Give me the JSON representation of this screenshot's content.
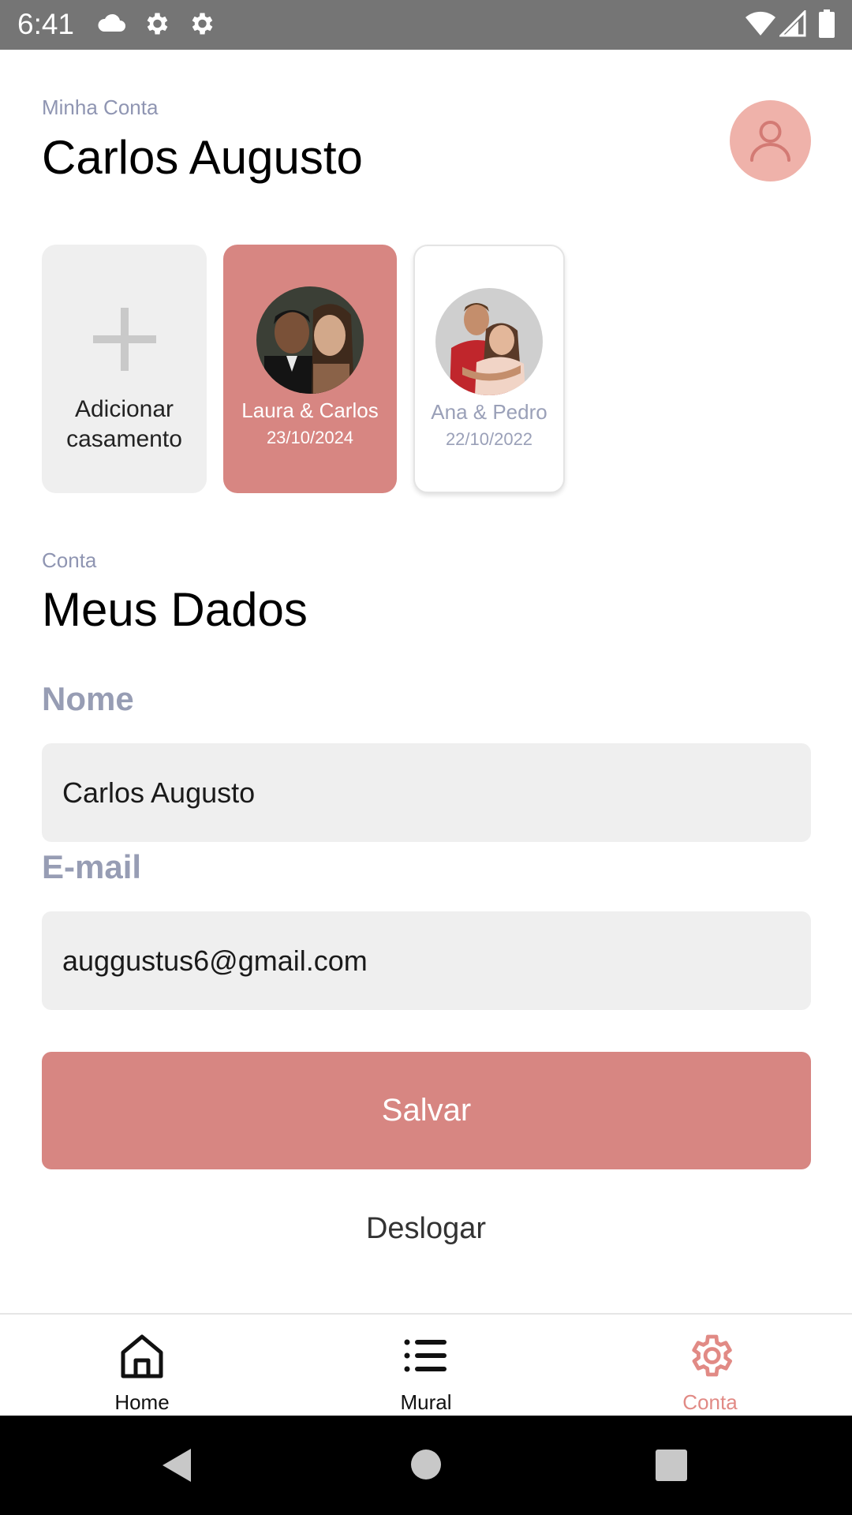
{
  "status_bar": {
    "time": "6:41",
    "icons": [
      "cloud-icon",
      "gear-icon",
      "gear-icon",
      "wifi-icon",
      "signal-icon",
      "battery-icon"
    ]
  },
  "header": {
    "label": "Minha Conta",
    "title": "Carlos Augusto",
    "avatar_icon": "user-icon",
    "avatar_color": "#efb2aa"
  },
  "weddings": {
    "add_label": "Adicionar casamento",
    "items": [
      {
        "name": "Laura & Carlos",
        "date": "23/10/2024",
        "selected": true
      },
      {
        "name": "Ana & Pedro",
        "date": "22/10/2022",
        "selected": false
      }
    ]
  },
  "section": {
    "label": "Conta",
    "title": "Meus Dados"
  },
  "form": {
    "name_label": "Nome",
    "name_value": "Carlos Augusto",
    "email_label": "E-mail",
    "email_value": "auggustus6@gmail.com",
    "save_label": "Salvar",
    "logout_label": "Deslogar"
  },
  "bottom_nav": {
    "items": [
      {
        "label": "Home",
        "icon": "home-icon",
        "active": false
      },
      {
        "label": "Mural",
        "icon": "list-icon",
        "active": false
      },
      {
        "label": "Conta",
        "icon": "gear-icon",
        "active": true
      }
    ]
  },
  "colors": {
    "accent": "#d78682",
    "active_nav": "#e18a85",
    "muted_label": "#979db4",
    "status_bar": "#757575"
  }
}
